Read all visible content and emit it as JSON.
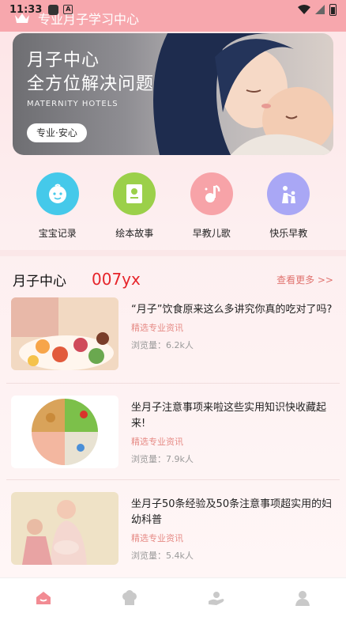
{
  "status": {
    "time": "11:33"
  },
  "header": {
    "title": "专业月子学习中心"
  },
  "banner": {
    "title_line1": "月子中心",
    "title_line2": "全方位解决问题",
    "subtitle": "MATERNITY HOTELS",
    "pill": "专业·安心"
  },
  "quick_links": [
    {
      "label": "宝宝记录",
      "icon": "baby-face-icon",
      "color": "#45c9ea"
    },
    {
      "label": "绘本故事",
      "icon": "picture-book-icon",
      "color": "#9bd04a"
    },
    {
      "label": "早教儿歌",
      "icon": "music-note-icon",
      "color": "#f7a3a8"
    },
    {
      "label": "快乐早教",
      "icon": "parent-child-icon",
      "color": "#a9a7f5"
    }
  ],
  "section": {
    "title": "月子中心",
    "tag": "007yx",
    "more": "查看更多 >>"
  },
  "articles": [
    {
      "title": "“月子”饮食原来这么多讲究你真的吃对了吗?",
      "category": "精选专业资讯",
      "views": "浏览量：6.2k人"
    },
    {
      "title": "坐月子注意事项来啦这些实用知识快收藏起来!",
      "category": "精选专业资讯",
      "views": "浏览量：7.9k人"
    },
    {
      "title": "坐月子50条经验及50条注意事项超实用的妇幼科普",
      "category": "精选专业资讯",
      "views": "浏览量：5.4k人"
    }
  ],
  "tabs": [
    {
      "icon": "home-icon",
      "active": true
    },
    {
      "icon": "chef-hat-icon",
      "active": false
    },
    {
      "icon": "care-hand-icon",
      "active": false
    },
    {
      "icon": "profile-icon",
      "active": false
    }
  ],
  "colors": {
    "accent": "#f28b93",
    "tag_red": "#e6242a",
    "inactive_tab": "#c9c9c9"
  }
}
